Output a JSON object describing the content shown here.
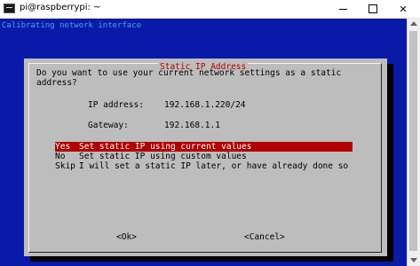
{
  "window": {
    "title": "pi@raspberrypi: ~",
    "minimize_glyph": "",
    "close_glyph": "✕"
  },
  "terminal": {
    "status_line": "Calibrating network interface"
  },
  "dialog": {
    "title": "Static IP Address",
    "message_line1": "Do you want to use your current network settings as a static",
    "message_line2": "address?",
    "ip_label": "IP address:",
    "ip_value": "192.168.1.220/24",
    "gateway_label": "Gateway:",
    "gateway_value": "192.168.1.1",
    "options": [
      {
        "key": "Yes",
        "desc": "Set static IP using current values"
      },
      {
        "key": "No",
        "desc": "Set static IP using custom values"
      },
      {
        "key": "Skip",
        "desc": "I will set a static IP later, or have already done so"
      }
    ],
    "ok_label": "<Ok>",
    "cancel_label": "<Cancel>"
  },
  "colors": {
    "terminal_bg": "#0a1aa8",
    "dialog_bg": "#bdbdbd",
    "highlight": "#b00000",
    "status_text": "#4aa3e8"
  }
}
